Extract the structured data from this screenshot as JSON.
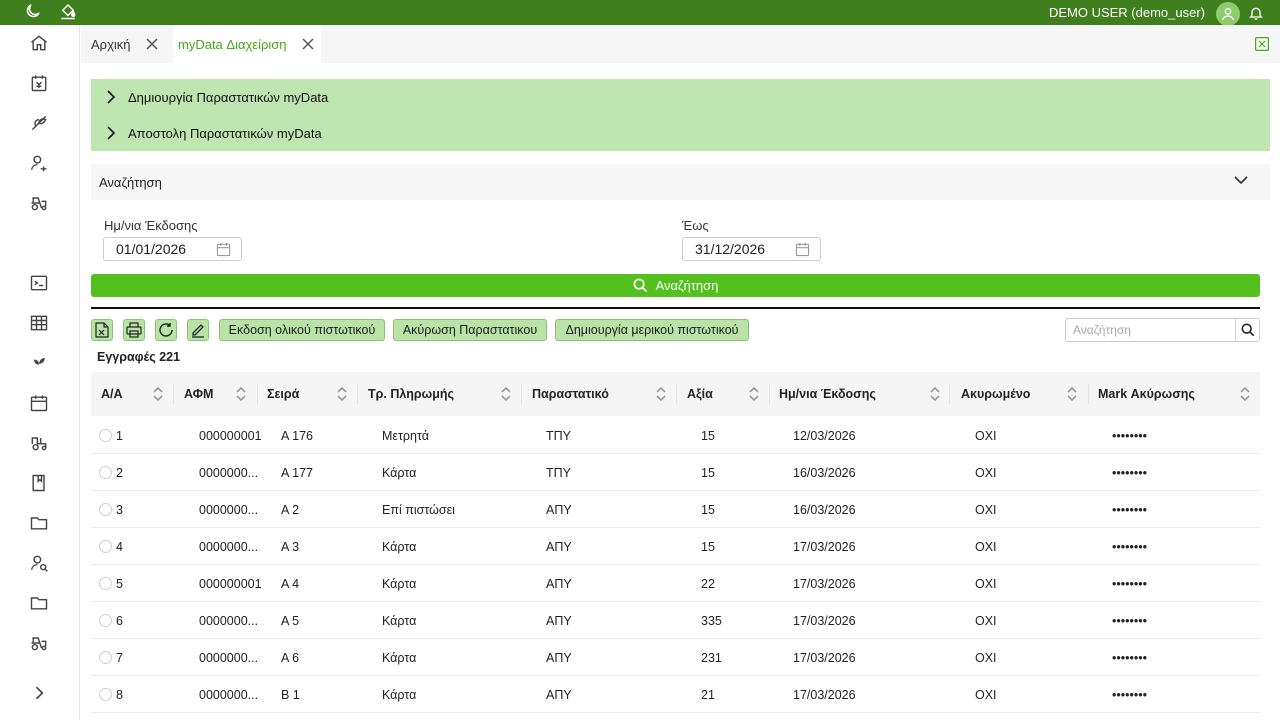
{
  "topbar": {
    "user_label": "DEMO USER (demo_user)",
    "icons": [
      "moon-icon",
      "paint-bucket-icon",
      "user-avatar-icon",
      "bell-icon"
    ]
  },
  "sidebar": {
    "icons": [
      "home-icon",
      "invoice-icon",
      "plant-icon",
      "user-settings-icon",
      "tractor-icon",
      "terminal-icon",
      "table-icon",
      "sprout-icon",
      "calendar-icon",
      "tractor-alt-icon",
      "book-icon",
      "folder-icon",
      "user-search-icon",
      "folder-alt-icon",
      "tractor-small-icon",
      "expand-icon"
    ]
  },
  "tabs": [
    {
      "label": "Αρχική",
      "active": false
    },
    {
      "label": "myData Διαχείριση",
      "active": true
    }
  ],
  "accordion": {
    "item1": "Δημιουργία Παραστατικών myData",
    "item2": "Αποστολη Παραστατικών myData"
  },
  "search_panel": {
    "title": "Αναζήτηση",
    "from_label": "Ημ/νια Έκδοσης",
    "from_value": "01/01/2026",
    "to_label": "Έως",
    "to_value": "31/12/2026",
    "button_label": "Αναζήτηση"
  },
  "toolbar": {
    "btn_full_credit": "Εκδοση ολικού πιστωτικού",
    "btn_cancel": "Ακύρωση Παραστατικου",
    "btn_partial_credit": "Δημιουργία μερικού πιστωτικού",
    "search_placeholder": "Αναζήτηση",
    "icons": [
      "excel-export-icon",
      "print-icon",
      "refresh-icon",
      "edit-icon"
    ]
  },
  "record_count": "Εγγραφές 221",
  "table": {
    "columns": [
      "Α/Α",
      "ΑΦΜ",
      "Σειρά",
      "Τρ. Πληρωμής",
      "Παραστατικό",
      "Αξία",
      "Ημ/νια Έκδοσης",
      "Ακυρωμένο",
      "Mark Ακύρωσης"
    ],
    "rows": [
      [
        "1",
        "000000001",
        "A 176",
        "Μετρητά",
        "ΤΠΥ",
        "15",
        "12/03/2026",
        "ΟΧΙ",
        "••••••••"
      ],
      [
        "2",
        "0000000...",
        "A 177",
        "Κάρτα",
        "ΤΠΥ",
        "15",
        "16/03/2026",
        "ΟΧΙ",
        "••••••••"
      ],
      [
        "3",
        "0000000...",
        "A 2",
        "Επί πιστώσει",
        "ΑΠΥ",
        "15",
        "16/03/2026",
        "ΟΧΙ",
        "••••••••"
      ],
      [
        "4",
        "0000000...",
        "A 3",
        "Κάρτα",
        "ΑΠΥ",
        "15",
        "17/03/2026",
        "ΟΧΙ",
        "••••••••"
      ],
      [
        "5",
        "000000001",
        "A 4",
        "Κάρτα",
        "ΑΠΥ",
        "22",
        "17/03/2026",
        "ΟΧΙ",
        "••••••••"
      ],
      [
        "6",
        "0000000...",
        "A 5",
        "Κάρτα",
        "ΑΠΥ",
        "335",
        "17/03/2026",
        "ΟΧΙ",
        "••••••••"
      ],
      [
        "7",
        "0000000...",
        "A 6",
        "Κάρτα",
        "ΑΠΥ",
        "231",
        "17/03/2026",
        "ΟΧΙ",
        "••••••••"
      ],
      [
        "8",
        "0000000...",
        "B 1",
        "Κάρτα",
        "ΑΠΥ",
        "21",
        "17/03/2026",
        "ΟΧΙ",
        "••••••••"
      ]
    ]
  },
  "colors": {
    "topbar": "#3f7f1e",
    "accent": "#53c01f",
    "accordion": "#bfe5b0",
    "active_tab": "#47a91b"
  }
}
